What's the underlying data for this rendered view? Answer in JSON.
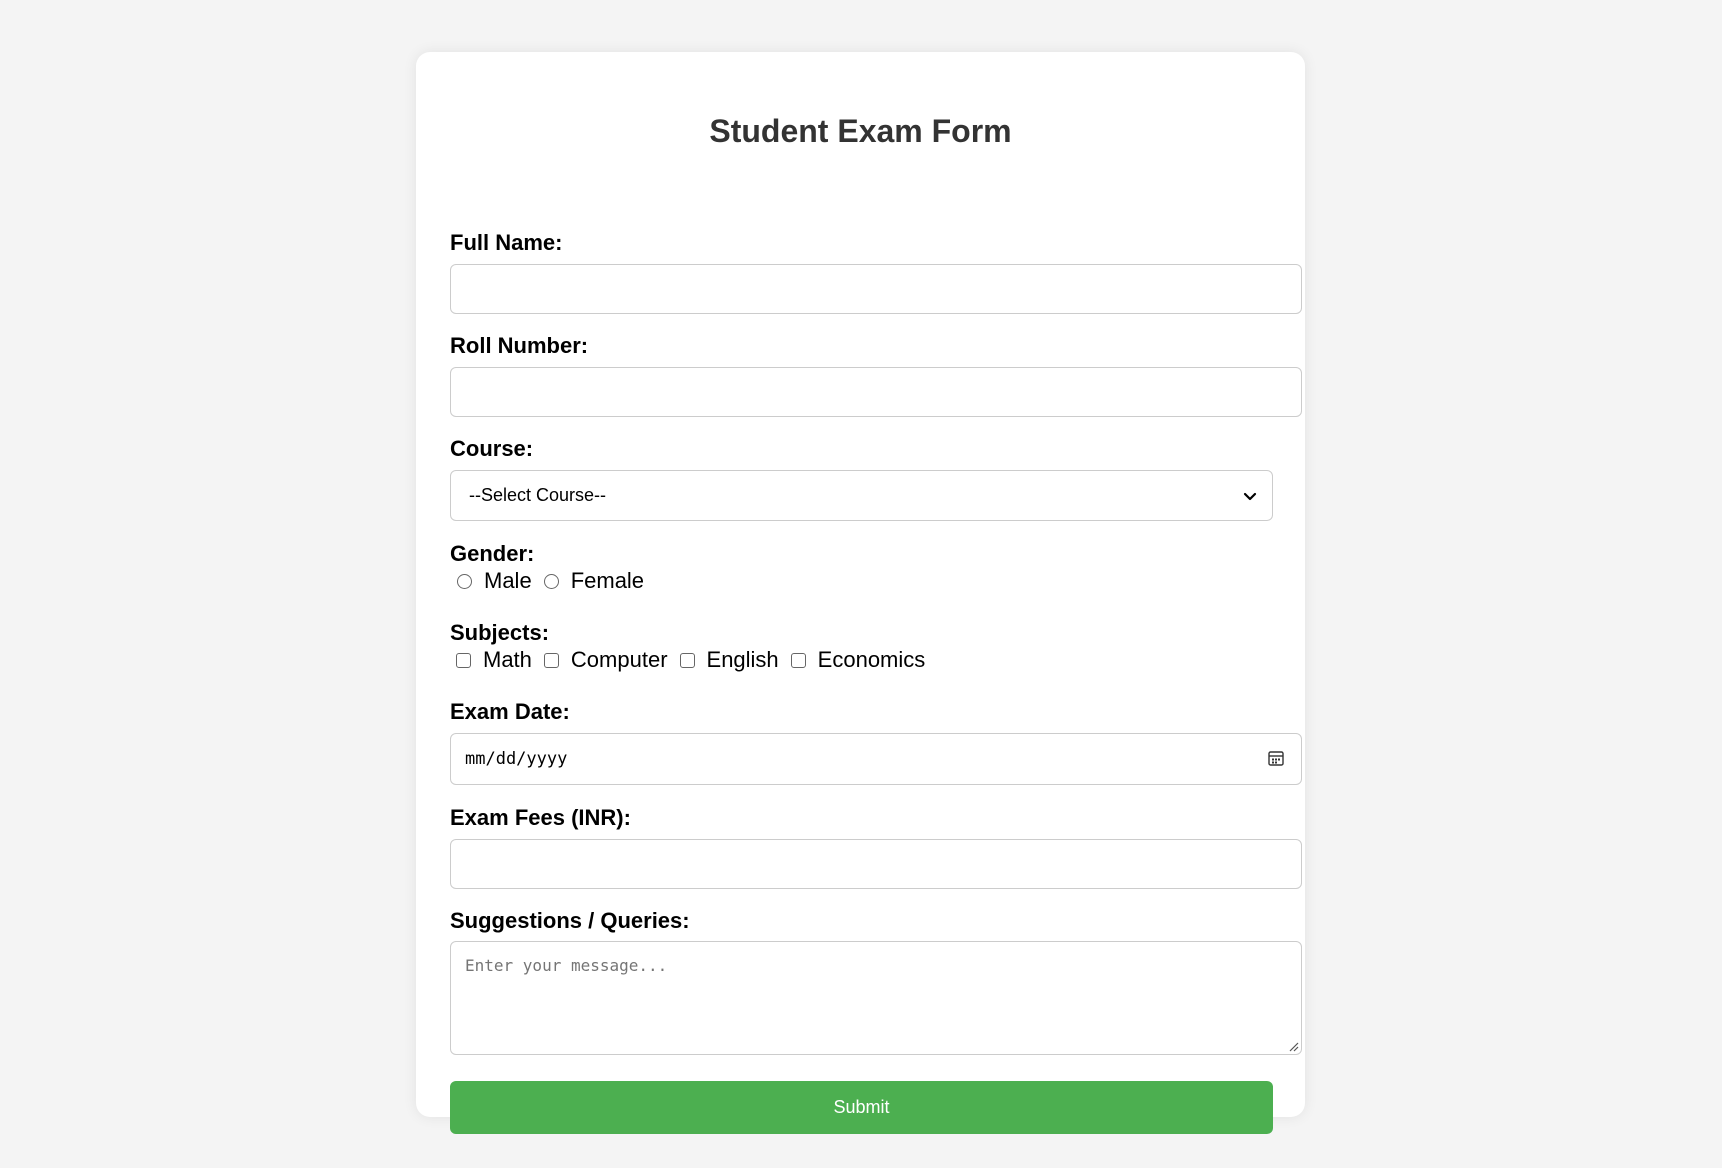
{
  "form": {
    "title": "Student Exam Form",
    "full_name": {
      "label": "Full Name:",
      "value": ""
    },
    "roll_number": {
      "label": "Roll Number:",
      "value": ""
    },
    "course": {
      "label": "Course:",
      "selected": "--Select Course--"
    },
    "gender": {
      "label": "Gender:",
      "options": [
        "Male",
        "Female"
      ]
    },
    "subjects": {
      "label": "Subjects:",
      "options": [
        "Math",
        "Computer",
        "English",
        "Economics"
      ]
    },
    "exam_date": {
      "label": "Exam Date:",
      "placeholder": "mm/dd/yyyy"
    },
    "exam_fees": {
      "label": "Exam Fees (INR):",
      "value": ""
    },
    "suggestions": {
      "label": "Suggestions / Queries:",
      "placeholder": "Enter your message..."
    },
    "submit_label": "Submit"
  },
  "colors": {
    "background": "#f4f4f4",
    "card": "#ffffff",
    "submit_button": "#4caf50",
    "title_text": "#333333"
  },
  "icons": {
    "select_arrow": "chevron-down-icon",
    "date_picker": "calendar-icon"
  }
}
